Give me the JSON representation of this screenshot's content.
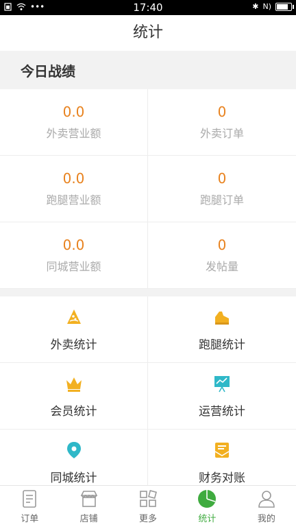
{
  "status_bar": {
    "time": "17:40"
  },
  "header": {
    "title": "统计"
  },
  "today": {
    "section_title": "今日战绩",
    "stats": [
      {
        "value": "0.0",
        "label": "外卖营业额"
      },
      {
        "value": "0",
        "label": "外卖订单"
      },
      {
        "value": "0.0",
        "label": "跑腿营业额"
      },
      {
        "value": "0",
        "label": "跑腿订单"
      },
      {
        "value": "0.0",
        "label": "同城营业额"
      },
      {
        "value": "0",
        "label": "发帖量"
      }
    ]
  },
  "tools": [
    {
      "label": "外卖统计",
      "icon": "pizza-icon",
      "color": "#f2b021"
    },
    {
      "label": "跑腿统计",
      "icon": "shoe-icon",
      "color": "#f2b021"
    },
    {
      "label": "会员统计",
      "icon": "crown-icon",
      "color": "#f2b021"
    },
    {
      "label": "运营统计",
      "icon": "presentation-icon",
      "color": "#2fb8c8"
    },
    {
      "label": "同城统计",
      "icon": "location-pin-icon",
      "color": "#2fb8c8"
    },
    {
      "label": "财务对账",
      "icon": "mail-icon",
      "color": "#f2b021"
    }
  ],
  "tab_bar": {
    "active_color": "#3fab3f",
    "items": [
      {
        "label": "订单",
        "icon": "order-icon"
      },
      {
        "label": "店铺",
        "icon": "store-icon"
      },
      {
        "label": "更多",
        "icon": "grid-icon"
      },
      {
        "label": "统计",
        "icon": "pie-chart-icon",
        "active": true
      },
      {
        "label": "我的",
        "icon": "user-icon"
      }
    ]
  }
}
